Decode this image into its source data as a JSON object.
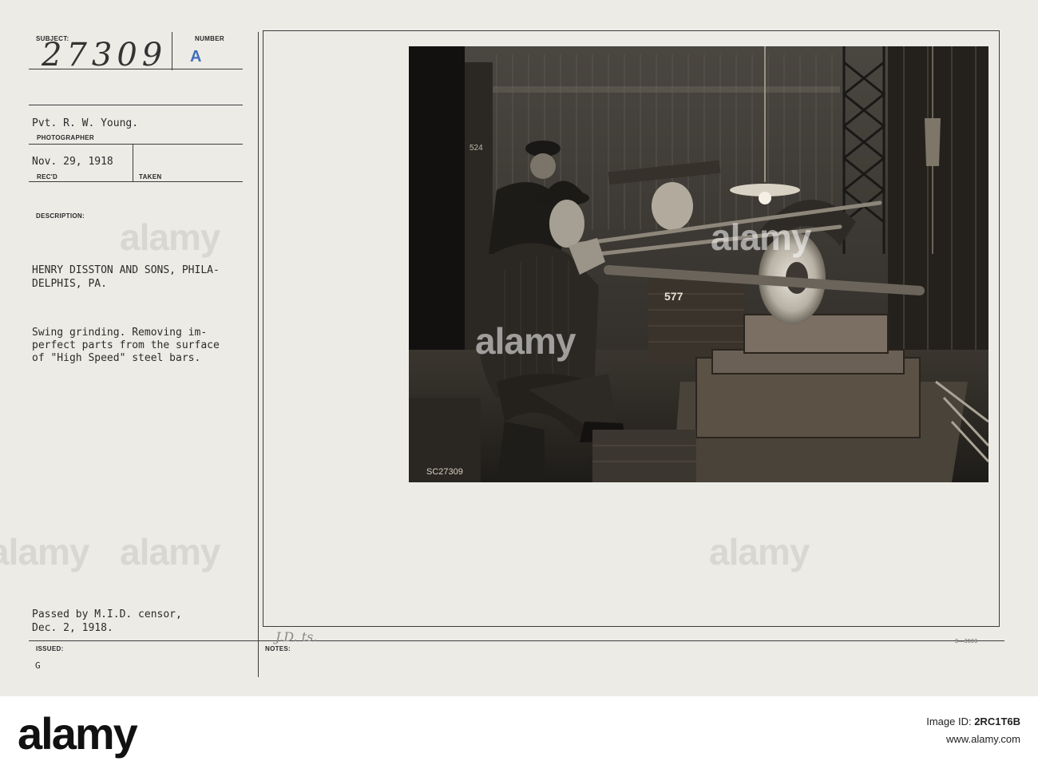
{
  "card": {
    "subject_label": "SUBJECT:",
    "number_label": "NUMBER",
    "subject_number": "27309",
    "number_value": "A",
    "photographer": "Pvt. R. W. Young.",
    "photographer_label": "PHOTOGRAPHER",
    "received_date": "Nov. 29, 1918",
    "recd_label": "REC'D",
    "taken_label": "TAKEN",
    "description_label": "DESCRIPTION:",
    "description_line1": "HENRY DISSTON AND SONS, PHILA-",
    "description_line2": "DELPHIS, PA.",
    "caption_line1": "Swing grinding. Removing im-",
    "caption_line2": "perfect parts from the surface",
    "caption_line3": "of \"High Speed\" steel bars.",
    "censor_line1": "Passed by M.I.D. censor,",
    "censor_line2": "Dec. 2, 1918.",
    "issued_label": "ISSUED:",
    "issued_value": "G",
    "notes_label": "NOTES:",
    "notes_handwriting": "J.D. ts.",
    "form_number": "3—3603"
  },
  "photo": {
    "negative_number": "SC27309",
    "wall_number_left": "524",
    "machine_number": "577"
  },
  "watermark": {
    "text": "alamy"
  },
  "footer": {
    "logo": "alamy",
    "image_id_label": "Image ID:",
    "image_id": "2RC1T6B",
    "url": "www.alamy.com"
  },
  "colors": {
    "card_bg": "#ecebe6",
    "stamp_blue": "#3f6fb8",
    "photo_bg": "#161513"
  }
}
